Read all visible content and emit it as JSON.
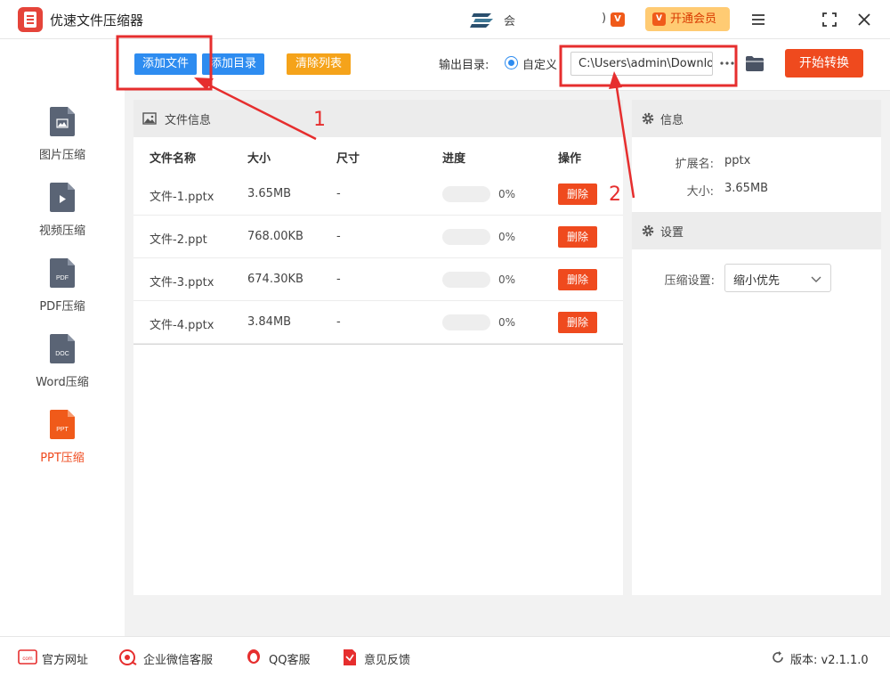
{
  "app": {
    "title": "优速文件压缩器"
  },
  "account": {
    "name_fragment": "会",
    "paren": ")"
  },
  "titlebar": {
    "vip_label": "开通会员",
    "vip_icon_text": "V"
  },
  "toolbar": {
    "add_file": "添加文件",
    "add_folder": "添加目录",
    "clear_list": "清除列表",
    "output_dir_label": "输出目录:",
    "custom_label": "自定义",
    "output_path": "C:\\Users\\admin\\Downloads",
    "start_label": "开始转换"
  },
  "sidebar": {
    "items": [
      {
        "label": "图片压缩",
        "icon_text": ""
      },
      {
        "label": "视频压缩",
        "icon_text": ""
      },
      {
        "label": "PDF压缩",
        "icon_text": "PDF"
      },
      {
        "label": "Word压缩",
        "icon_text": "DOC"
      },
      {
        "label": "PPT压缩",
        "icon_text": "PPT"
      }
    ],
    "active_index": 4
  },
  "file_panel": {
    "title": "文件信息",
    "columns": {
      "name": "文件名称",
      "size": "大小",
      "dims": "尺寸",
      "progress": "进度",
      "action": "操作"
    },
    "rows": [
      {
        "name": "文件-1.pptx",
        "size": "3.65MB",
        "dims": "-",
        "progress": "0%",
        "progress_value": 0,
        "action": "删除"
      },
      {
        "name": "文件-2.ppt",
        "size": "768.00KB",
        "dims": "-",
        "progress": "0%",
        "progress_value": 0,
        "action": "删除"
      },
      {
        "name": "文件-3.pptx",
        "size": "674.30KB",
        "dims": "-",
        "progress": "0%",
        "progress_value": 0,
        "action": "删除"
      },
      {
        "name": "文件-4.pptx",
        "size": "3.84MB",
        "dims": "-",
        "progress": "0%",
        "progress_value": 0,
        "action": "删除"
      }
    ]
  },
  "info_panel": {
    "title": "信息",
    "ext_label": "扩展名:",
    "ext_value": "pptx",
    "size_label": "大小:",
    "size_value": "3.65MB"
  },
  "settings_panel": {
    "title": "设置",
    "compress_label": "压缩设置:",
    "compress_value": "缩小优先"
  },
  "annotations": {
    "one": "1",
    "two": "2"
  },
  "footer": {
    "website": "官方网址",
    "wechat": "企业微信客服",
    "qq": "QQ客服",
    "feedback": "意见反馈",
    "version": "版本: v2.1.1.0",
    "com_icon_text": "com"
  },
  "colors": {
    "accent_blue": "#2e8cf0",
    "accent_red": "#ef4a1e",
    "accent_orange": "#f5a31a",
    "vip_bg": "#ffcb73"
  }
}
